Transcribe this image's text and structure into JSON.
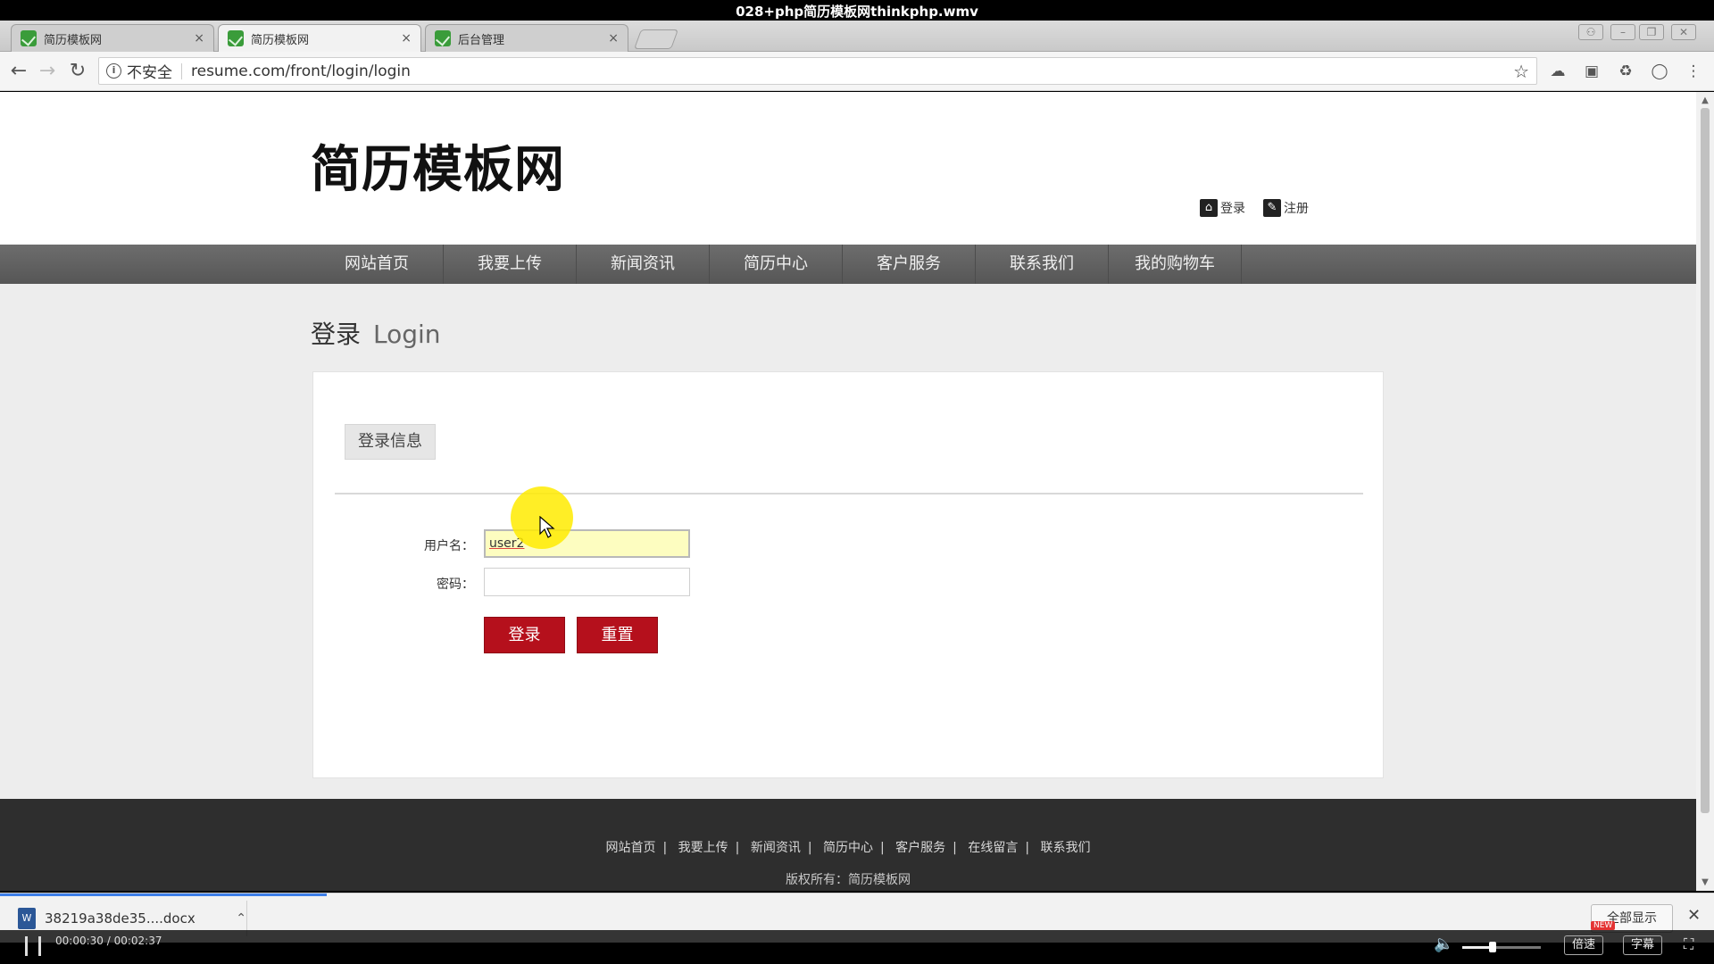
{
  "video": {
    "title": "028+php简历模板网thinkphp.wmv",
    "time": "00:00:30 / 00:02:37",
    "speed_label": "倍速",
    "speed_badge": "NEW",
    "subtitle_label": "字幕",
    "volume_percent": 35
  },
  "browser": {
    "tabs": [
      {
        "title": "简历模板网",
        "active": false
      },
      {
        "title": "简历模板网",
        "active": true
      },
      {
        "title": "后台管理",
        "active": false
      }
    ],
    "tab_close": "×",
    "security_label": "不安全",
    "url": "resume.com/front/login/login"
  },
  "site": {
    "logo": "简历模板网",
    "header_links": {
      "login": "登录",
      "register": "注册"
    },
    "nav": [
      "网站首页",
      "我要上传",
      "新闻资讯",
      "简历中心",
      "客户服务",
      "联系我们",
      "我的购物车"
    ]
  },
  "login": {
    "heading_cn": "登录",
    "heading_en": "Login",
    "panel_tab": "登录信息",
    "username_label": "用户名：",
    "username_value": "user2",
    "password_label": "密码：",
    "submit_label": "登录",
    "reset_label": "重置"
  },
  "footer": {
    "links": [
      "网站首页",
      "我要上传",
      "新闻资讯",
      "简历中心",
      "客户服务",
      "在线留言",
      "联系我们"
    ],
    "separator": "|",
    "copyright": "版权所有：简历模板网"
  },
  "download": {
    "filename": "38219a38de35....docx",
    "show_all": "全部显示"
  }
}
